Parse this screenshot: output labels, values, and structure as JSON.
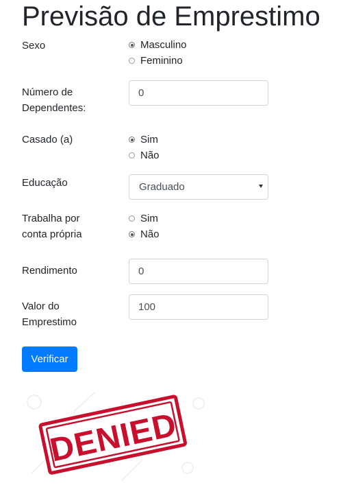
{
  "title": "Previsão de Emprestimo",
  "fields": {
    "sexo": {
      "label": "Sexo",
      "options": [
        "Masculino",
        "Feminino"
      ],
      "selected": "Masculino"
    },
    "dependentes": {
      "label_line1": "Número de",
      "label_line2": "Dependentes:",
      "value": "0"
    },
    "casado": {
      "label": "Casado (a)",
      "options": [
        "Sim",
        "Não"
      ],
      "selected": "Sim"
    },
    "educacao": {
      "label": "Educação",
      "value": "Graduado"
    },
    "trabalha": {
      "label_line1": "Trabalha por",
      "label_line2": "conta própria",
      "options": [
        "Sim",
        "Não"
      ],
      "selected": "Não"
    },
    "rendimento": {
      "label": "Rendimento",
      "value": "0"
    },
    "emprestimo": {
      "label_line1": "Valor do",
      "label_line2": "Emprestimo",
      "value": "100"
    }
  },
  "button": {
    "label": "Verificar"
  },
  "result_stamp": {
    "text": "DENIED",
    "color": "#c8102e"
  },
  "colors": {
    "primary": "#007bff",
    "text": "#212529",
    "border": "#ced4da"
  }
}
